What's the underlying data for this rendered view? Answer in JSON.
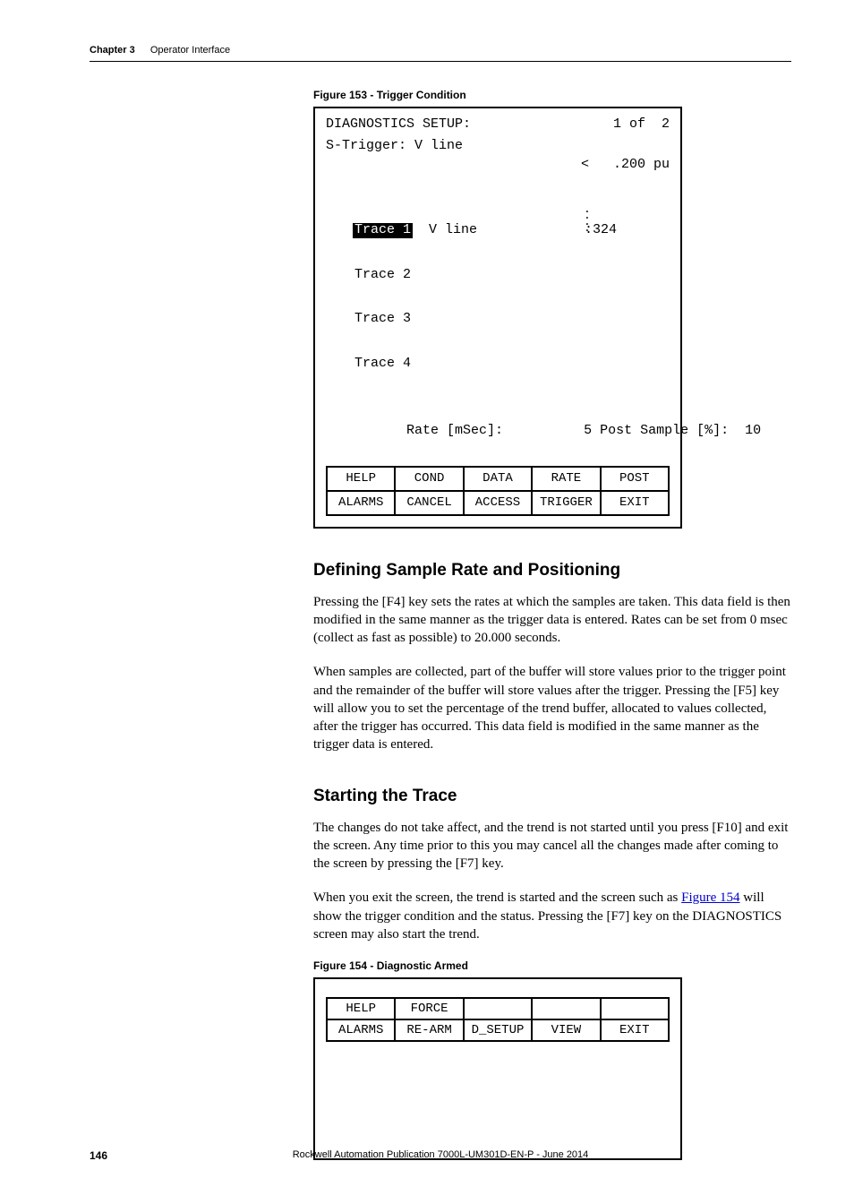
{
  "header": {
    "chapter": "Chapter 3",
    "section": "Operator Interface"
  },
  "figure153": {
    "caption": "Figure 153 - Trigger Condition",
    "title": "DIAGNOSTICS SETUP:",
    "pager": "1 of  2",
    "trigger_label": "S-Trigger: V line",
    "trigger_op": "<",
    "trigger_val": ".200 pu",
    "traces": [
      {
        "label": "Trace 1",
        "value": "V line",
        "readout": ":324",
        "selected": true
      },
      {
        "label": "Trace 2"
      },
      {
        "label": "Trace 3"
      },
      {
        "label": "Trace 4"
      }
    ],
    "rate_label": "Rate [mSec]:",
    "rate_val": "5",
    "post_label": "Post Sample [%]:",
    "post_val": "10",
    "row1": [
      "HELP",
      "COND",
      "DATA",
      "RATE",
      "POST"
    ],
    "row2": [
      "ALARMS",
      "CANCEL",
      "ACCESS",
      "TRIGGER",
      "EXIT"
    ]
  },
  "sectionA": {
    "heading": "Defining Sample Rate and Positioning",
    "p1": "Pressing the [F4] key sets the rates at which the samples are taken. This data field is then modified in the same manner as the trigger data is entered. Rates can be set from 0 msec (collect as fast as possible) to 20.000 seconds.",
    "p2": "When samples are collected, part of the buffer will store values prior to the trigger point and the remainder of the buffer will store values after the trigger. Pressing the [F5] key will allow you to set the percentage of the trend buffer, allocated to values collected, after the trigger has occurred. This data field is modified in the same manner as the trigger data is entered."
  },
  "sectionB": {
    "heading": "Starting the Trace",
    "p1": "The changes do not take affect, and the trend is not started until you press [F10] and exit the screen. Any time prior to this you may cancel all the changes made after coming to the screen by pressing the [F7] key.",
    "p2a": "When you exit the screen, the trend is started and the screen such as ",
    "p2link": "Figure 154",
    "p2b": " will show the trigger condition and the status. Pressing the [F7] key on the DIAGNOSTICS screen may also start the trend."
  },
  "figure154": {
    "caption": "Figure 154 - Diagnostic Armed",
    "row1": [
      "HELP",
      "FORCE",
      "",
      "",
      ""
    ],
    "row2": [
      "ALARMS",
      "RE-ARM",
      "D_SETUP",
      "VIEW",
      "EXIT"
    ]
  },
  "footer": {
    "page": "146",
    "pub": "Rockwell Automation Publication 7000L-UM301D-EN-P - June 2014"
  }
}
